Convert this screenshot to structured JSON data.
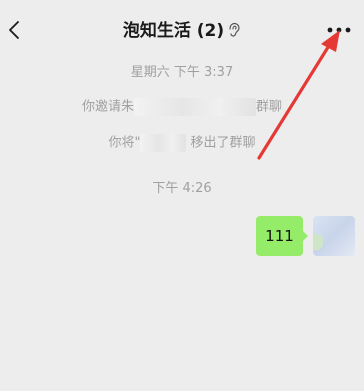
{
  "header": {
    "title": "泡知生活 (2)",
    "back_icon": "chevron-left-icon",
    "mute_icon": "ear-icon",
    "more_icon": "more-dots-icon"
  },
  "messages": {
    "time1": "星期六 下午 3:37",
    "invite_prefix": "你邀请朱",
    "invite_suffix": "群聊",
    "remove_prefix": "你将\"",
    "remove_suffix": "移出了群聊",
    "time2": "下午 4:26",
    "sent_text": "111"
  },
  "colors": {
    "bubble": "#95ec69",
    "annotation_arrow": "#e53935"
  }
}
